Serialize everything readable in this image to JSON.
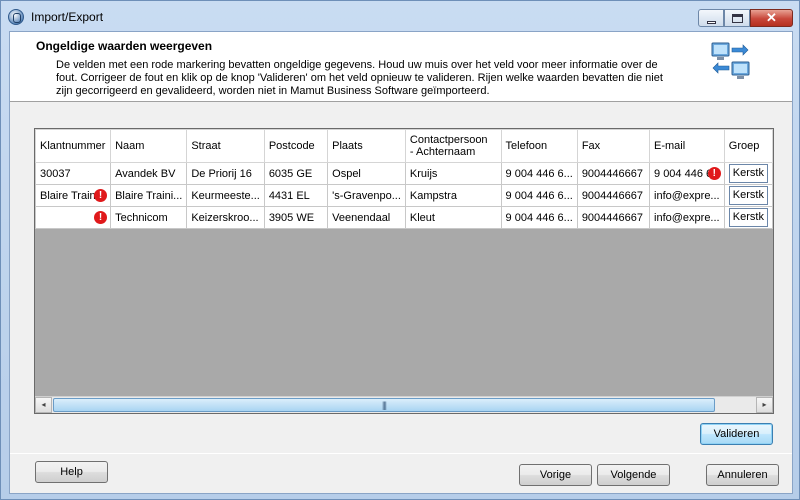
{
  "window": {
    "title": "Import/Export"
  },
  "header": {
    "title": "Ongeldige waarden weergeven",
    "description": "De velden met een rode markering bevatten ongeldige gegevens. Houd uw muis over het veld voor meer informatie over de fout. Corrigeer de fout en klik op de knop 'Valideren' om het veld opnieuw te valideren. Rijen welke waarden bevatten die niet zijn gecorrigeerd en gevalideerd, worden niet in Mamut Business Software geïmporteerd."
  },
  "grid": {
    "columns": [
      {
        "line1": "Klantnummer",
        "line2": ""
      },
      {
        "line1": "Naam",
        "line2": ""
      },
      {
        "line1": "Straat",
        "line2": ""
      },
      {
        "line1": "Postcode",
        "line2": ""
      },
      {
        "line1": "Plaats",
        "line2": ""
      },
      {
        "line1": "Contactpersoon",
        "line2": "- Achternaam"
      },
      {
        "line1": "Telefoon",
        "line2": ""
      },
      {
        "line1": "Fax",
        "line2": ""
      },
      {
        "line1": "E-mail",
        "line2": ""
      },
      {
        "line1": "Groep",
        "line2": ""
      }
    ],
    "rows": [
      {
        "klantnummer": "30037",
        "klantnummer_error": false,
        "naam": "Avandek BV",
        "straat": "De Priorij 16",
        "postcode": "6035 GE",
        "plaats": "Ospel",
        "contact": "Kruijs",
        "telefoon": "9 004 446 6...",
        "fax": "9004446667",
        "email": "9 004 446 6",
        "email_error": true,
        "groep": "Kerstk"
      },
      {
        "klantnummer": "Blaire Traini",
        "klantnummer_error": true,
        "naam": "Blaire Traini...",
        "straat": "Keurmeeste...",
        "postcode": "4431 EL",
        "plaats": "'s-Gravenpo...",
        "contact": "Kampstra",
        "telefoon": "9 004 446 6...",
        "fax": "9004446667",
        "email": "info@expre...",
        "email_error": false,
        "groep": "Kerstk"
      },
      {
        "klantnummer": "",
        "klantnummer_error": true,
        "naam": "Technicom",
        "straat": "Keizerskroo...",
        "postcode": "3905 WE",
        "plaats": "Veenendaal",
        "contact": "Kleut",
        "telefoon": "9 004 446 6...",
        "fax": "9004446667",
        "email": "info@expre...",
        "email_error": false,
        "groep": "Kerstk"
      }
    ],
    "error_icon_glyph": "!",
    "scroll_left_glyph": "◂",
    "scroll_right_glyph": "▸",
    "scroll_grip_glyph": "|||"
  },
  "buttons": {
    "validate": "Valideren",
    "help": "Help",
    "previous": "Vorige",
    "next": "Volgende",
    "cancel": "Annuleren"
  },
  "colors": {
    "error": "#e0191b",
    "titlebar": "#c9dcf2",
    "grid_background": "#a9a9a9"
  }
}
